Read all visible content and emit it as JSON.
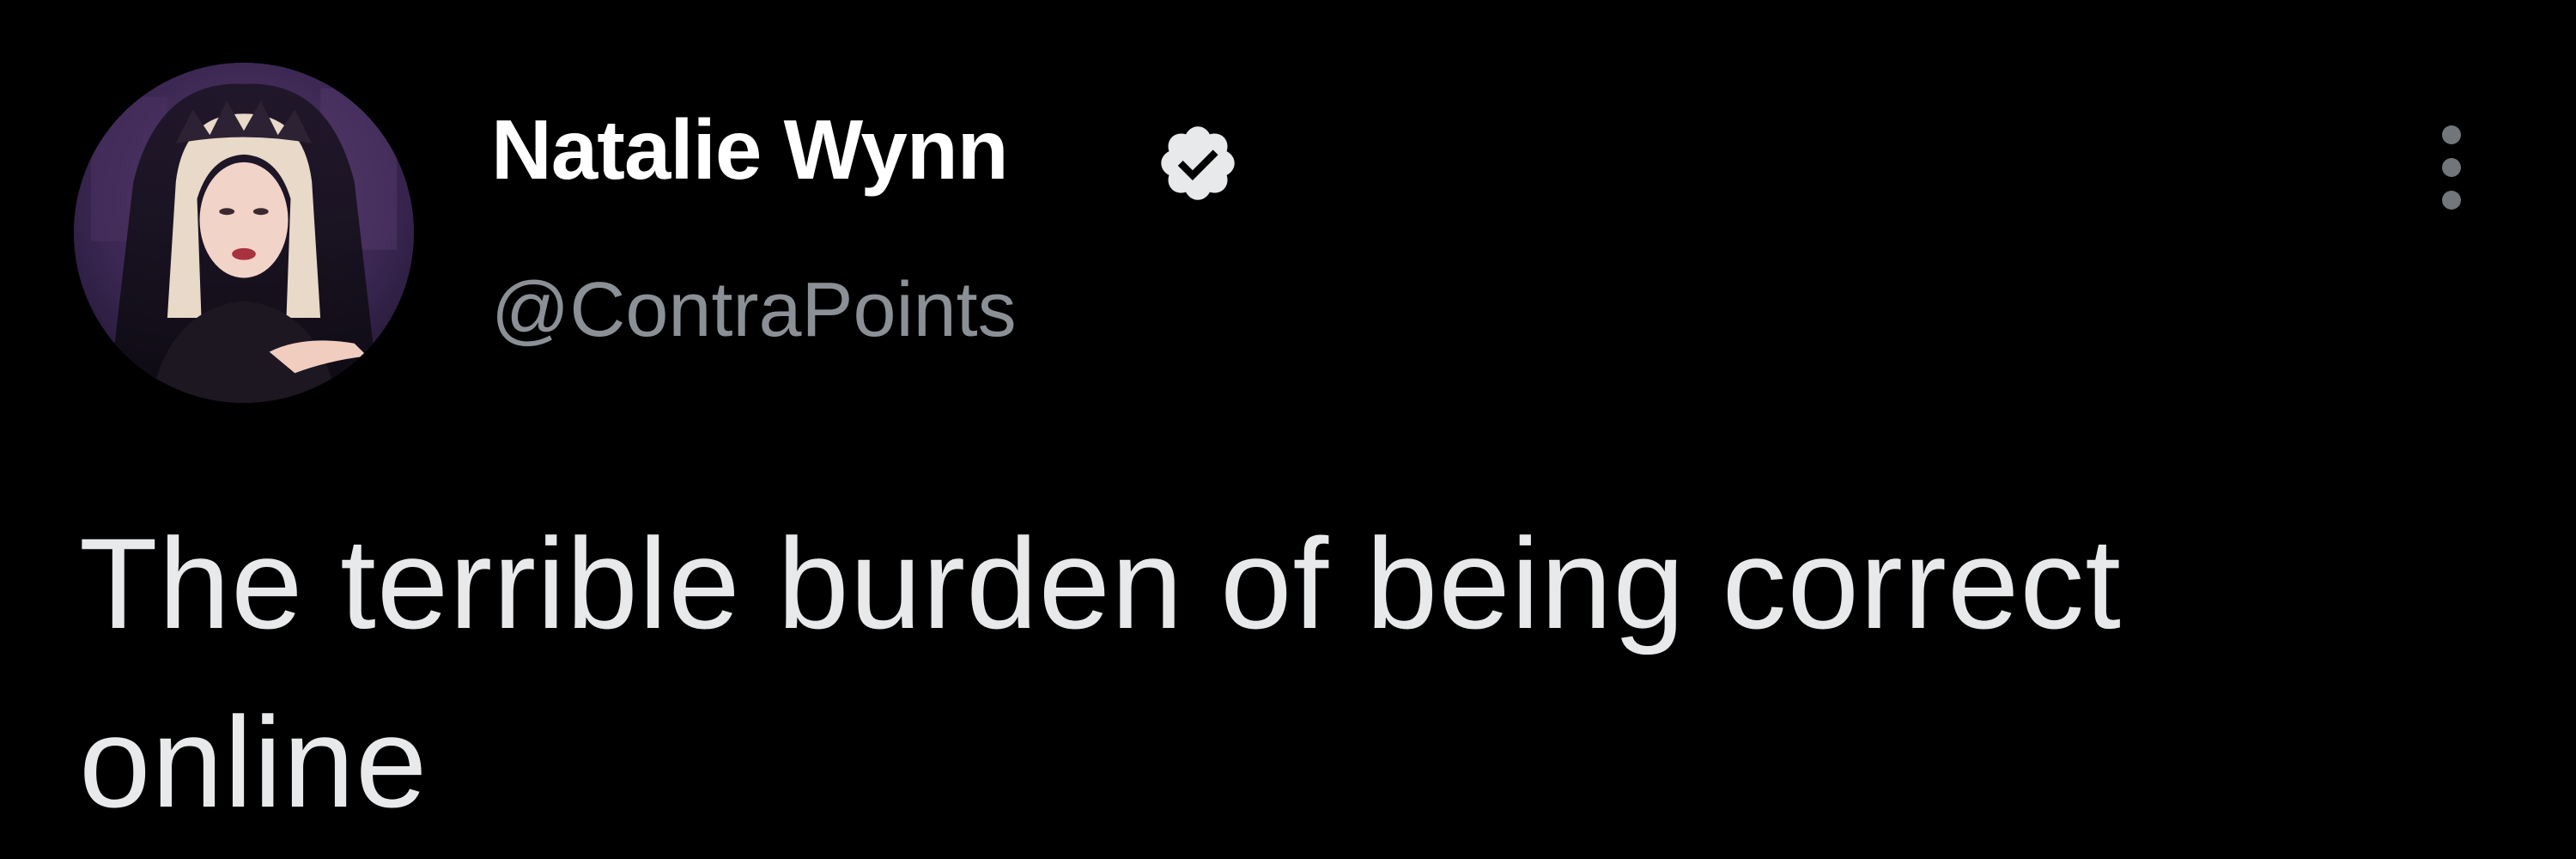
{
  "author": {
    "display_name": "Natalie Wynn",
    "handle": "@ContraPoints",
    "verified": true,
    "avatar_icon": "profile-photo",
    "verified_icon": "verified-badge-icon"
  },
  "tweet": {
    "text": "The terrible burden of being correct online"
  },
  "actions": {
    "more_icon": "more-options-icon"
  },
  "colors": {
    "background": "#000000",
    "name": "#ffffff",
    "handle": "#8b9096",
    "text": "#e7e9ea",
    "badge": "#e7e9ea"
  }
}
